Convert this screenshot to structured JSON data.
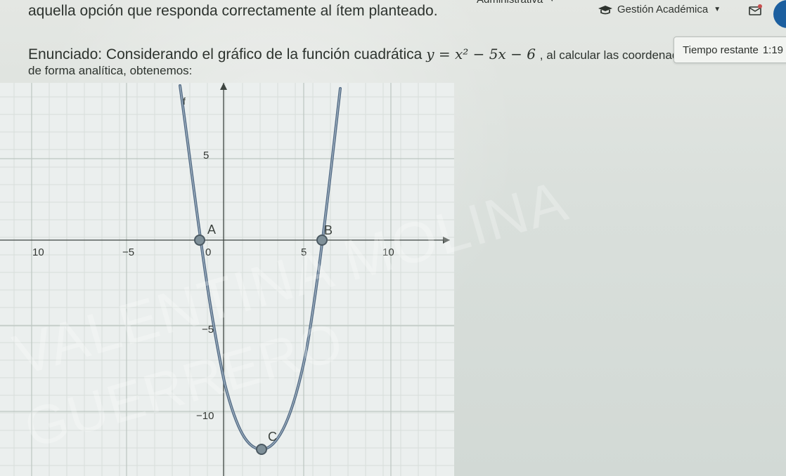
{
  "top_nav": {
    "admin_label": "Administrativa",
    "gestion_label": "Gestión Académica"
  },
  "colors": {
    "accent_blue": "#1c5f9f",
    "curve": "#546c86",
    "point": "#7f9099",
    "axis": "#3e4541"
  },
  "question": {
    "instruction": "aquella opción que responda correctamente al ítem planteado.",
    "statement_part1": "Enunciado: Considerando el gráfico de la función cuadrática ",
    "equation": "y = x² − 5x − 6",
    "statement_part2": ", al calcular las coordenadas de sus raíces de forma analítica, obtenemos:"
  },
  "timer": {
    "label": "Tiempo restante",
    "value": "1:19"
  },
  "graph": {
    "function_label": "f",
    "points": {
      "a": "A",
      "b": "B",
      "c": "C"
    },
    "x_ticks": [
      "10",
      "−5",
      "0",
      "5",
      "10"
    ],
    "y_ticks": [
      "5",
      "−5",
      "−10"
    ]
  },
  "watermark": {
    "line1": "VALENTINA MOLINA",
    "line2": "GUERRERO"
  }
}
